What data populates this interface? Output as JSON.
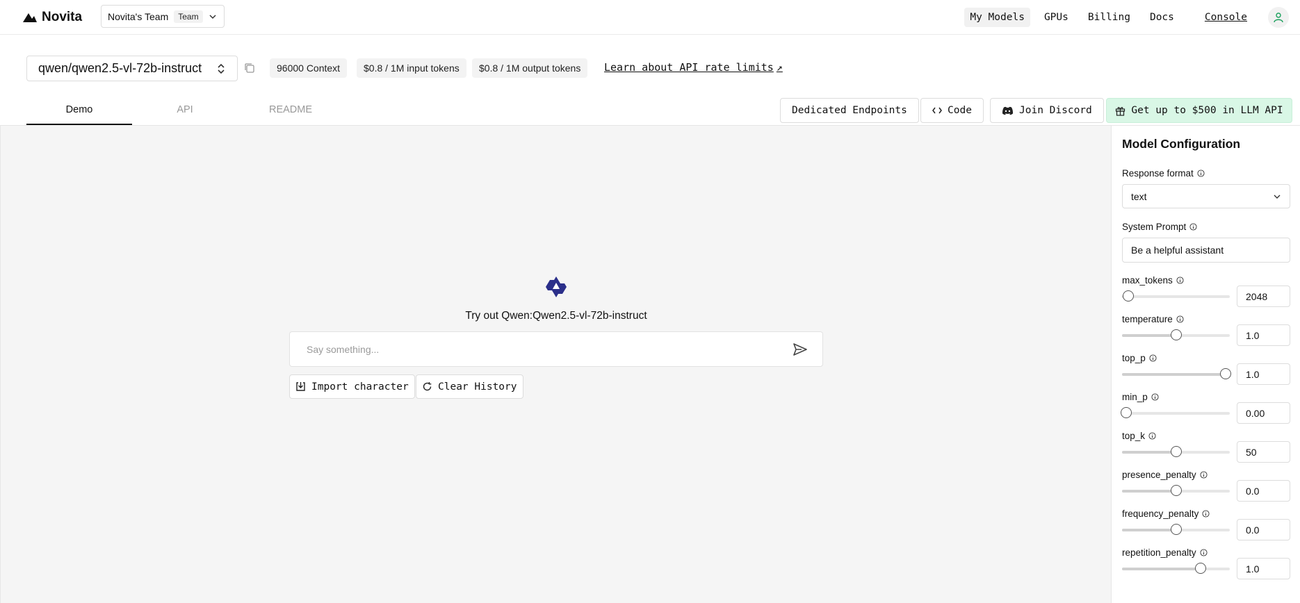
{
  "brand": {
    "name": "Novita"
  },
  "team": {
    "name": "Novita's Team",
    "badge": "Team"
  },
  "nav": {
    "links": [
      "My Models",
      "GPUs",
      "Billing",
      "Docs"
    ],
    "console": "Console"
  },
  "model": {
    "name": "qwen/qwen2.5-vl-72b-instruct",
    "chips": [
      "96000 Context",
      "$0.8 / 1M input tokens",
      "$0.8 / 1M output tokens"
    ],
    "rate_link": "Learn about API rate limits",
    "rate_arrow": "↗"
  },
  "tabs": [
    "Demo",
    "API",
    "README"
  ],
  "actions": {
    "dedicated": "Dedicated Endpoints",
    "code": "Code",
    "discord": "Join Discord",
    "promo": "Get up to $500 in LLM API"
  },
  "chat": {
    "title": "Try out Qwen:Qwen2.5-vl-72b-instruct",
    "placeholder": "Say something...",
    "import_label": "Import character",
    "clear_label": "Clear History"
  },
  "config": {
    "title": "Model Configuration",
    "response_format": {
      "label": "Response format",
      "value": "text"
    },
    "system_prompt": {
      "label": "System Prompt",
      "value": "Be a helpful assistant"
    },
    "params": [
      {
        "label": "max_tokens",
        "value": "2048",
        "fraction": 0.06
      },
      {
        "label": "temperature",
        "value": "1.0",
        "fraction": 0.5
      },
      {
        "label": "top_p",
        "value": "1.0",
        "fraction": 0.96
      },
      {
        "label": "min_p",
        "value": "0.00",
        "fraction": 0.04
      },
      {
        "label": "top_k",
        "value": "50",
        "fraction": 0.5
      },
      {
        "label": "presence_penalty",
        "value": "0.0",
        "fraction": 0.5
      },
      {
        "label": "frequency_penalty",
        "value": "0.0",
        "fraction": 0.5
      },
      {
        "label": "repetition_penalty",
        "value": "1.0",
        "fraction": 0.73
      }
    ]
  },
  "colors": {
    "promo_bg": "#d9f7e6",
    "accent_green": "#1aa05c",
    "qwen_blue": "#2b2f8a"
  }
}
